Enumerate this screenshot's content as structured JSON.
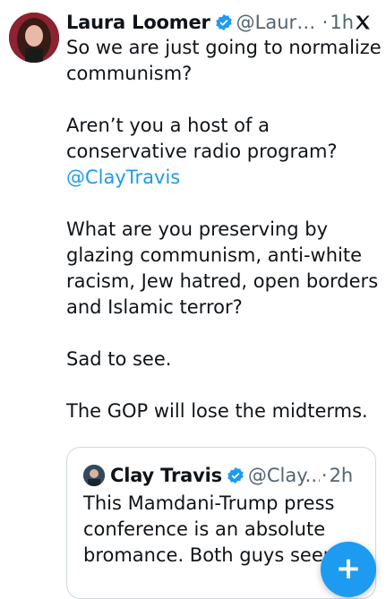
{
  "tweet": {
    "author_name": "Laura Loomer",
    "handle": "@Laura...",
    "separator": "·",
    "time": "1h",
    "paragraphs": [
      "So we are just going to normalize communism?",
      "Aren’t you a host of a conservative radio program?",
      "What are you preserving by glazing communism, anti-white racism, Jew hatred, open borders and Islamic terror?",
      "Sad to see.",
      "The GOP will lose the midterms."
    ],
    "mention": "@ClayTravis"
  },
  "quote": {
    "author_name": "Clay Travis",
    "handle": "@Clay...",
    "separator": "·",
    "time": "2h",
    "text": "This Mamdani-Trump press conference is an absolute bromance. Both guys seem"
  },
  "icons": {
    "verified": "verified-badge-icon",
    "logo": "x-logo-icon",
    "compose": "plus-icon"
  },
  "colors": {
    "accent": "#1d9bf0",
    "secondary_text": "#536471",
    "text": "#0f1419",
    "border": "#cfd9de"
  }
}
